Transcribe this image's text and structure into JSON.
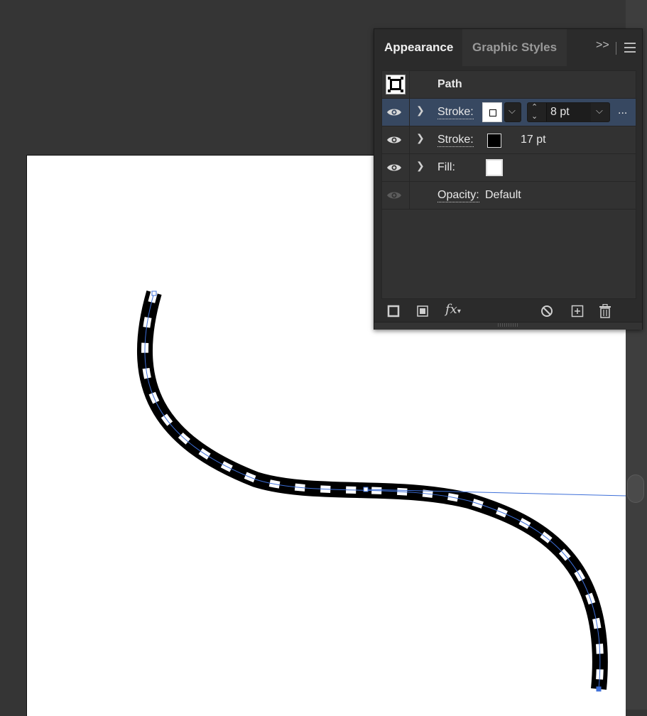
{
  "panel": {
    "tabs": [
      "Appearance",
      "Graphic Styles"
    ],
    "overflow_label": ">>",
    "target_label": "Path",
    "rows": [
      {
        "label": "Stroke:",
        "weight_input": "8 pt",
        "more": "..."
      },
      {
        "label": "Stroke:",
        "weight": "17 pt"
      },
      {
        "label": "Fill:"
      },
      {
        "label": "Opacity:",
        "value": "Default"
      }
    ],
    "toolbar": {
      "fx_label": "fx"
    }
  },
  "colors": {
    "background": "#353535",
    "panel": "#2b2b2b",
    "selected_row": "#374861",
    "path_guide": "#3d6fd8",
    "stroke_outer": "#000000",
    "stroke_inner": "#ffffff"
  },
  "icons": [
    "eye-icon",
    "chevron-right-icon",
    "chevron-down-icon",
    "menu-icon",
    "new-stroke-icon",
    "new-fill-icon",
    "no-icon",
    "add-icon",
    "trash-icon"
  ]
}
